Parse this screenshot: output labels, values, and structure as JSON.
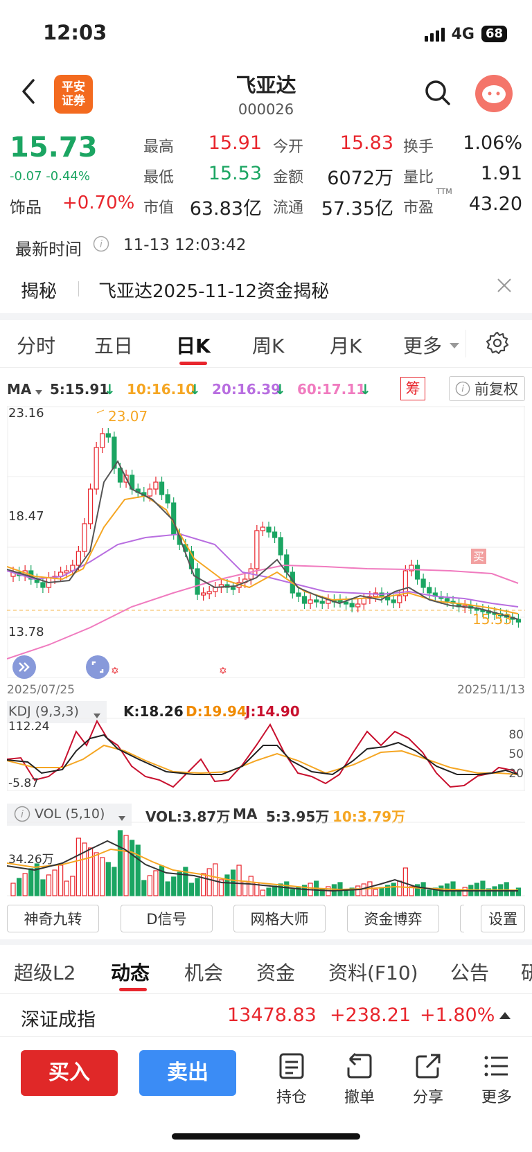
{
  "status": {
    "time": "12:03",
    "network": "4G",
    "battery": "68"
  },
  "header": {
    "logo_line1": "平安",
    "logo_line2": "证券",
    "stock_name": "飞亚达",
    "stock_code": "000026"
  },
  "quote": {
    "price": "15.73",
    "change": "-0.07 -0.44%",
    "sector_label": "饰品",
    "sector_change": "+0.70%",
    "rows": [
      [
        {
          "label": "最高",
          "value": "15.91",
          "color": "red"
        },
        {
          "label": "今开",
          "value": "15.83",
          "color": "red"
        },
        {
          "label": "换手",
          "value": "1.06%",
          "color": "black"
        }
      ],
      [
        {
          "label": "最低",
          "value": "15.53",
          "color": "green"
        },
        {
          "label": "金额",
          "value": "6072万",
          "color": "black"
        },
        {
          "label": "量比",
          "value": "1.91",
          "color": "black"
        }
      ],
      [
        {
          "label": "市值",
          "value": "63.83亿",
          "color": "black"
        },
        {
          "label": "流通",
          "value": "57.35亿",
          "color": "black"
        },
        {
          "label": "市盈",
          "value": "43.20",
          "color": "black"
        }
      ]
    ],
    "pe_suffix": "TTM",
    "update_label": "最新时间",
    "update_time": "11-13 12:03:42"
  },
  "news": {
    "label": "揭秘",
    "text": "飞亚达2025-11-12资金揭秘"
  },
  "period_tabs": [
    "分时",
    "五日",
    "日K",
    "周K",
    "月K",
    "更多"
  ],
  "active_period": "日K",
  "ma": {
    "label": "MA",
    "items": [
      {
        "text": "5:15.91",
        "color": "#333333"
      },
      {
        "text": "10:16.10",
        "color": "#f5a623"
      },
      {
        "text": "20:16.39",
        "color": "#b86ee0"
      },
      {
        "text": "60:17.11",
        "color": "#f07bbf"
      }
    ],
    "chip_label": "筹",
    "adjust_label": "前复权"
  },
  "kchart": {
    "y_top": "23.16",
    "y_mid": "18.47",
    "y_bottom": "13.78",
    "max_label": "23.07",
    "min_label": "15.53",
    "buy_marker": "买",
    "date_start": "2025/07/25",
    "date_end": "2025/11/13"
  },
  "chart_data": {
    "type": "candlestick",
    "x_range": [
      "2025/07/25",
      "2025/11/13"
    ],
    "ylim": [
      13.78,
      23.16
    ],
    "high_label": 23.07,
    "low_label": 15.53,
    "ma": {
      "5": 15.91,
      "10": 16.1,
      "20": 16.39,
      "60": 17.11
    },
    "kdj": {
      "params": "9,3,3",
      "K": 18.26,
      "D": 19.94,
      "J": 14.9,
      "ylim": [
        -5.87,
        112.24
      ],
      "levels": [
        80,
        50,
        20
      ]
    },
    "vol": {
      "params": "5,10",
      "VOL": "3.87万",
      "MA5": "3.95万",
      "MA10": "3.79万",
      "max": "34.26万"
    }
  },
  "kdj": {
    "title": "KDJ (9,3,3)",
    "k": "K:18.26",
    "d": "D:19.94",
    "j": "J:14.90",
    "y_top": "112.24",
    "y_bottom": "-5.87",
    "l80": "80",
    "l50": "50",
    "l20": "20"
  },
  "vol": {
    "title": "VOL (5,10)",
    "vol": "VOL:3.87万",
    "ma_label": "MA",
    "ma5": "5:3.95万",
    "ma10": "10:3.79万",
    "y_top": "34.26万"
  },
  "tools": [
    "神奇九转",
    "D信号",
    "网格大师",
    "资金博弈",
    "设置"
  ],
  "bottom_tabs": [
    "超级L2",
    "动态",
    "机会",
    "资金",
    "资料(F10)",
    "公告",
    "研"
  ],
  "index": {
    "name": "深证成指",
    "value": "13478.83",
    "change": "+238.21",
    "pct": "+1.80%"
  },
  "actions": {
    "buy": "买入",
    "sell": "卖出",
    "hold": "持仓",
    "cancel": "撤单",
    "share": "分享",
    "more": "更多"
  }
}
